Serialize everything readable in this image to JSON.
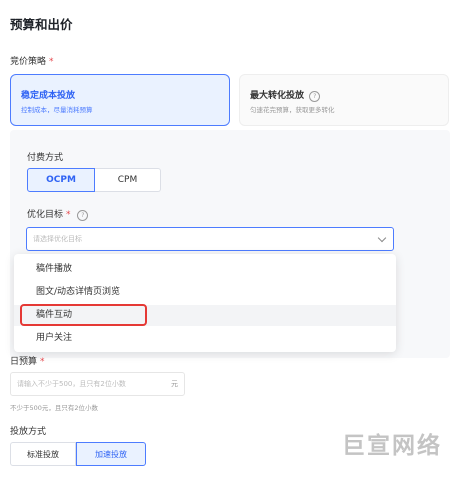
{
  "section_title": "预算和出价",
  "bid_strategy": {
    "label": "竞价策略",
    "required": "*",
    "options": [
      {
        "title": "稳定成本投放",
        "desc": "控制成本，尽量消耗预算",
        "selected": true
      },
      {
        "title": "最大转化投放",
        "desc": "匀速花完预算，获取更多转化",
        "selected": false
      }
    ]
  },
  "pay_method": {
    "label": "付费方式",
    "options": [
      "OCPM",
      "CPM"
    ],
    "selected": "OCPM"
  },
  "opt_goal": {
    "label": "优化目标",
    "required": "*",
    "placeholder": "请选择优化目标",
    "dropdown_options": [
      "稿件播放",
      "图文/动态详情页浏览",
      "稿件互动",
      "用户关注"
    ],
    "highlighted_option": "稿件互动"
  },
  "daily_budget": {
    "label": "日预算",
    "required": "*",
    "placeholder": "请输入不少于500，且只有2位小数",
    "unit": "元",
    "hint": "不少于500元，且只有2位小数"
  },
  "delivery_method": {
    "label": "投放方式",
    "options": [
      "标准投放",
      "加速投放"
    ],
    "selected": "加速投放"
  },
  "watermark": "巨宣网络",
  "colors": {
    "accent": "#4d7cff",
    "highlight": "#e53935",
    "required": "#e5484d"
  }
}
